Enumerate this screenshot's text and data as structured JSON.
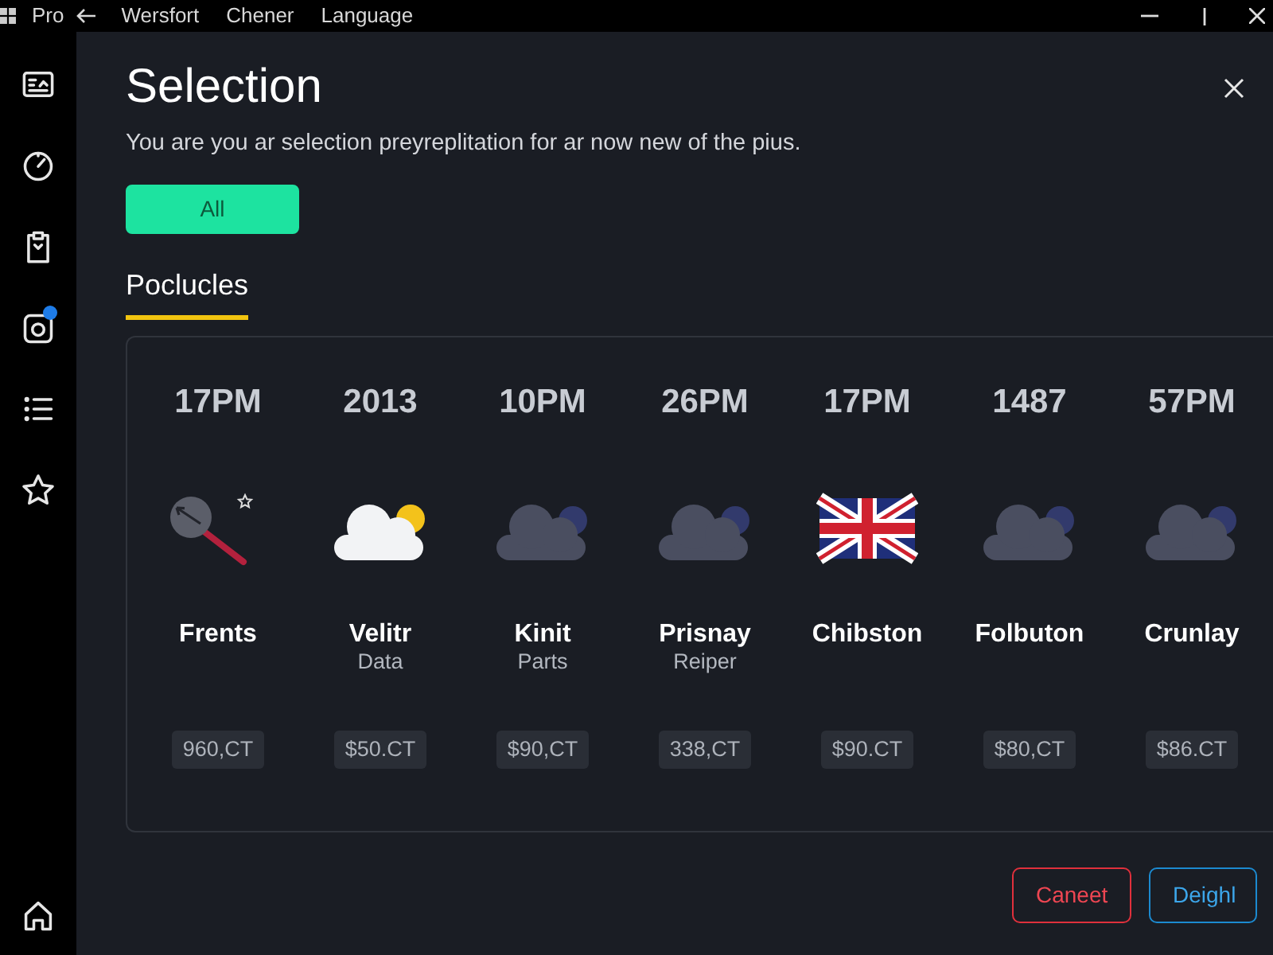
{
  "window": {
    "app_name": "Pro",
    "menu": [
      "Wersfort",
      "Chener",
      "Language"
    ]
  },
  "sidebar": {
    "items": [
      {
        "kind": "card",
        "badge": false
      },
      {
        "kind": "gauge",
        "badge": false
      },
      {
        "kind": "clipboard",
        "badge": false
      },
      {
        "kind": "camera",
        "badge": true
      },
      {
        "kind": "list",
        "badge": false
      },
      {
        "kind": "star",
        "badge": false
      }
    ],
    "footer": [
      {
        "kind": "home",
        "badge": false
      }
    ]
  },
  "dialog": {
    "title": "Selection",
    "subtitle": "You are you ar selection preyreplitation for ar now new of the pius.",
    "filter": {
      "label": "All",
      "selected": true
    },
    "tabs": [
      {
        "label": "Poclucles",
        "selected": true
      }
    ],
    "items": [
      {
        "time": "17PM",
        "kind": "magnifier",
        "name": "Frents",
        "price": "960,CT"
      },
      {
        "time": "2013",
        "kind": "cloud-sun",
        "name": "Velitr",
        "subtitle": "Data",
        "price": "$50.CT"
      },
      {
        "time": "10PM",
        "kind": "cloud",
        "name": "Kinit",
        "subtitle": "Parts",
        "price": "$90,CT"
      },
      {
        "time": "26PM",
        "kind": "cloud",
        "name": "Prisnay",
        "subtitle": "Reiper",
        "price": "338,CT"
      },
      {
        "time": "17PM",
        "kind": "flag",
        "name": "Chibston",
        "price": "$90.CT"
      },
      {
        "time": "1487",
        "kind": "cloud",
        "name": "Folbuton",
        "price": "$80,CT"
      },
      {
        "time": "57PM",
        "kind": "cloud",
        "name": "Crunlay",
        "price": "$86.CT"
      }
    ],
    "buttons": [
      {
        "label": "Caneet",
        "kind": "cancel"
      },
      {
        "label": "Deighl",
        "kind": "confirm"
      }
    ]
  }
}
